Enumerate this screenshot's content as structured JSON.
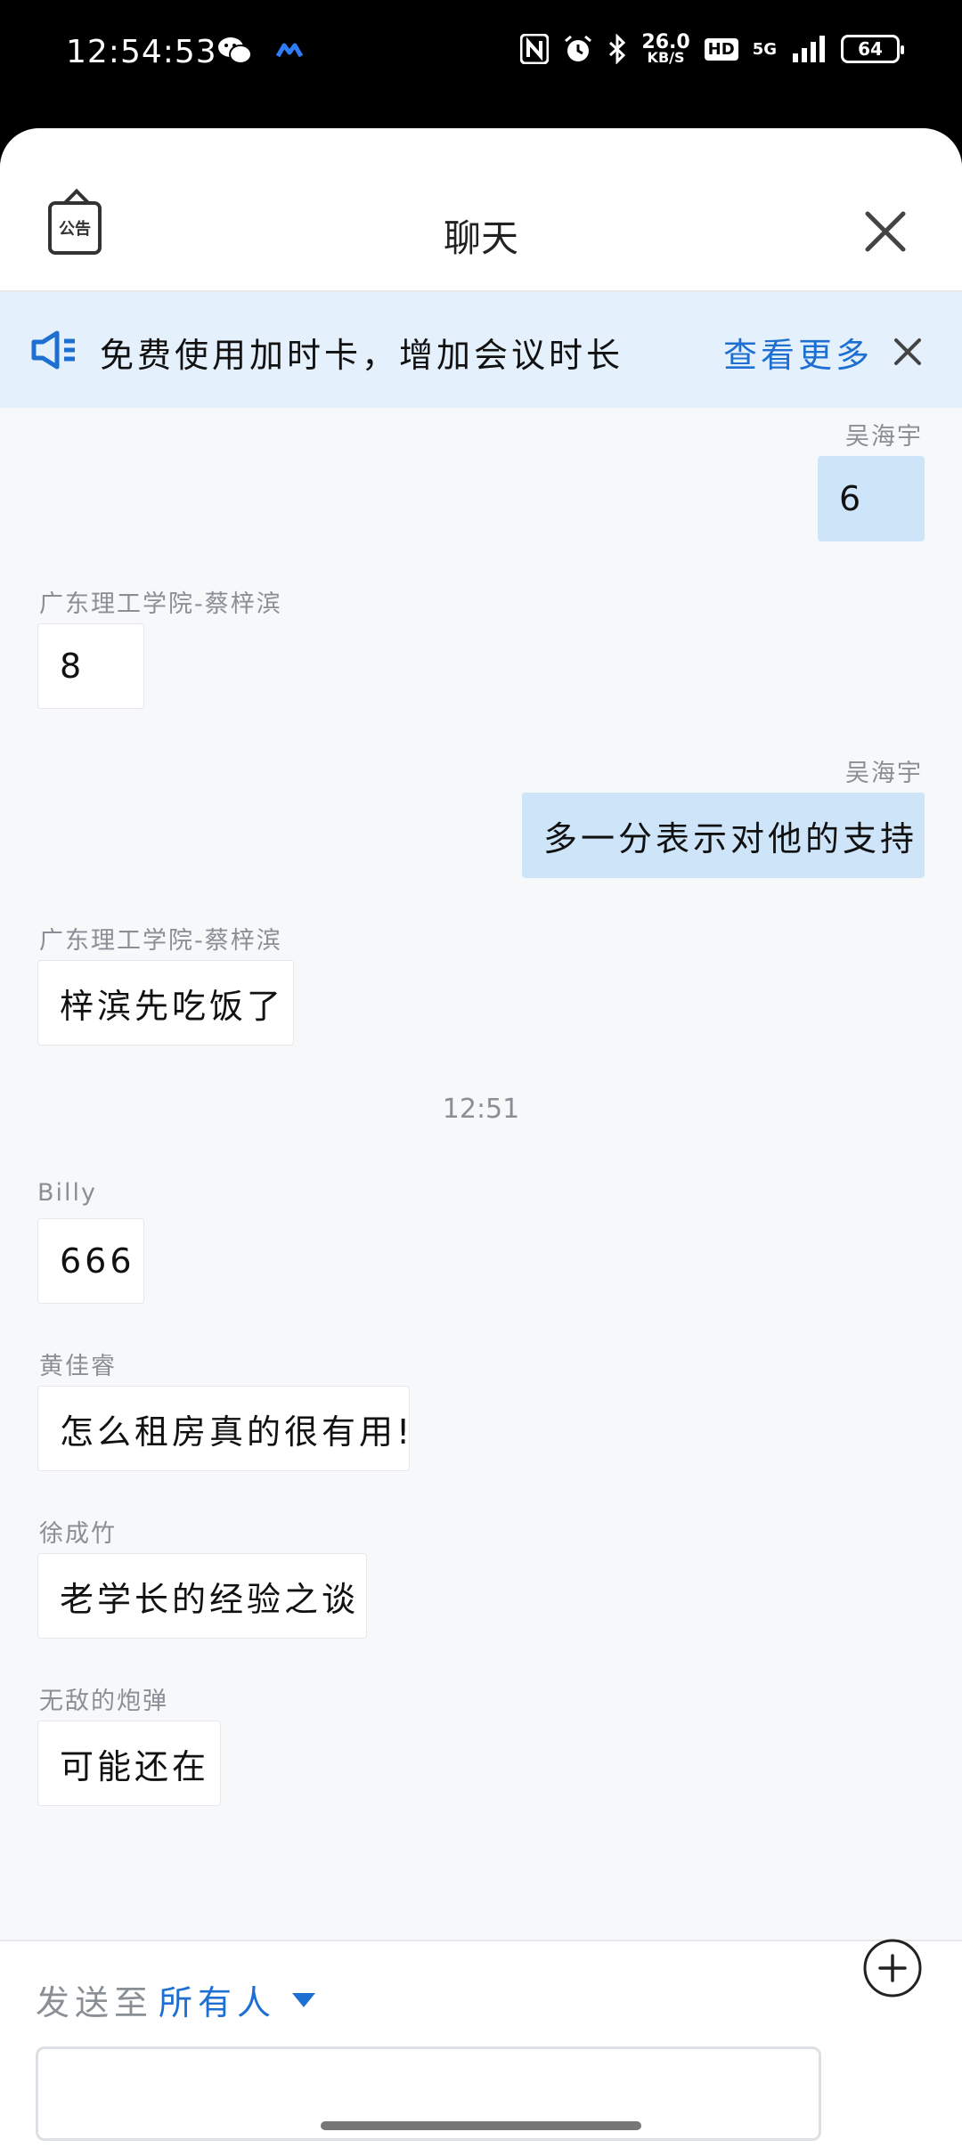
{
  "status_bar": {
    "time": "12:54:53",
    "net_speed_value": "26.0",
    "net_speed_unit": "KB/S",
    "hd_badge": "HD",
    "network": "5G",
    "battery": "64",
    "icons": [
      "wechat-icon",
      "app-notification-icon",
      "nfc-icon",
      "alarm-icon",
      "bluetooth-icon",
      "signal-icon"
    ]
  },
  "header": {
    "notice_label": "公告",
    "title": "聊天"
  },
  "banner": {
    "text": "免费使用加时卡，增加会议时长",
    "more_label": "查看更多"
  },
  "messages": [
    {
      "sender": "吴海宇",
      "text": "6",
      "direction": "out"
    },
    {
      "sender": "广东理工学院-蔡梓滨",
      "text": "8",
      "direction": "in"
    },
    {
      "sender": "吴海宇",
      "text": "多一分表示对他的支持",
      "direction": "out"
    },
    {
      "sender": "广东理工学院-蔡梓滨",
      "text": "梓滨先吃饭了",
      "direction": "in"
    },
    {
      "timestamp": "12:51"
    },
    {
      "sender": "Billy",
      "text": "666",
      "direction": "in"
    },
    {
      "sender": "黄佳睿",
      "text": "怎么租房真的很有用!",
      "direction": "in"
    },
    {
      "sender": "徐成竹",
      "text": "老学长的经验之谈",
      "direction": "in"
    },
    {
      "sender": "无敌的炮弹",
      "text": "可能还在",
      "direction": "in"
    }
  ],
  "footer": {
    "send_to_label": "发送至",
    "send_target": "所有人",
    "input_value": "",
    "input_placeholder": ""
  },
  "colors": {
    "accent": "#1d6fd1",
    "out_bubble": "#cde4f9",
    "banner_bg": "#e4f0fb",
    "chat_bg": "#f7f8fa"
  }
}
